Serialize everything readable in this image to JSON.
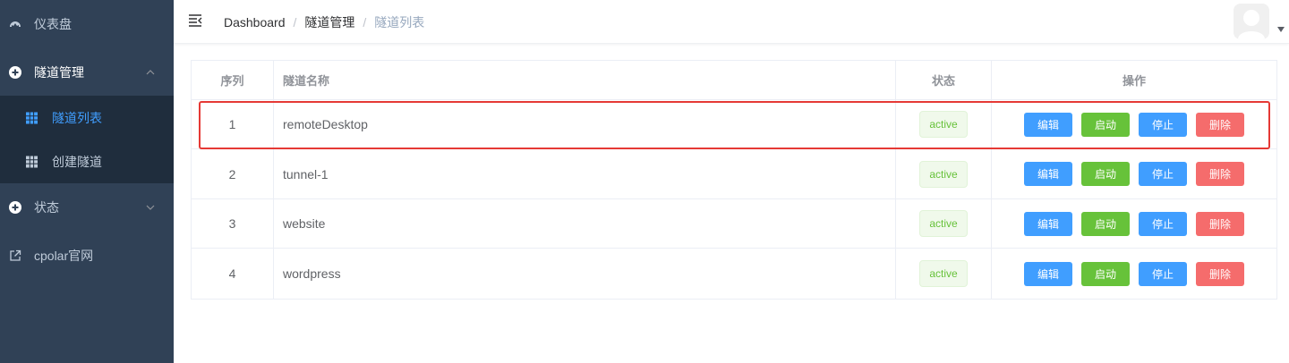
{
  "sidebar": {
    "dashboard": {
      "label": "仪表盘",
      "icon": "dashboard-icon"
    },
    "tunnel_mgmt": {
      "label": "隧道管理",
      "icon": "plus-circle-icon",
      "expanded": true
    },
    "tunnel_list": {
      "label": "隧道列表",
      "icon": "grid-icon",
      "active": true
    },
    "create_tunnel": {
      "label": "创建隧道",
      "icon": "grid-icon"
    },
    "status": {
      "label": "状态",
      "icon": "plus-circle-icon"
    },
    "cpolar_site": {
      "label": "cpolar官网",
      "icon": "external-link-icon"
    }
  },
  "navbar": {
    "breadcrumb": [
      "Dashboard",
      "隧道管理",
      "隧道列表"
    ],
    "separator": "/"
  },
  "table": {
    "headers": {
      "index": "序列",
      "name": "隧道名称",
      "status": "状态",
      "ops": "操作"
    },
    "rows": [
      {
        "index": "1",
        "name": "remoteDesktop",
        "status": "active"
      },
      {
        "index": "2",
        "name": "tunnel-1",
        "status": "active"
      },
      {
        "index": "3",
        "name": "website",
        "status": "active"
      },
      {
        "index": "4",
        "name": "wordpress",
        "status": "active"
      }
    ],
    "actions": {
      "edit": "编辑",
      "start": "启动",
      "stop": "停止",
      "delete": "删除"
    }
  },
  "colors": {
    "sidebar_bg": "#304156",
    "submenu_bg": "#1f2d3d",
    "active_text": "#409eff",
    "primary": "#409eff",
    "success": "#67c23a",
    "danger": "#f56c6c",
    "highlight": "#e53935"
  }
}
